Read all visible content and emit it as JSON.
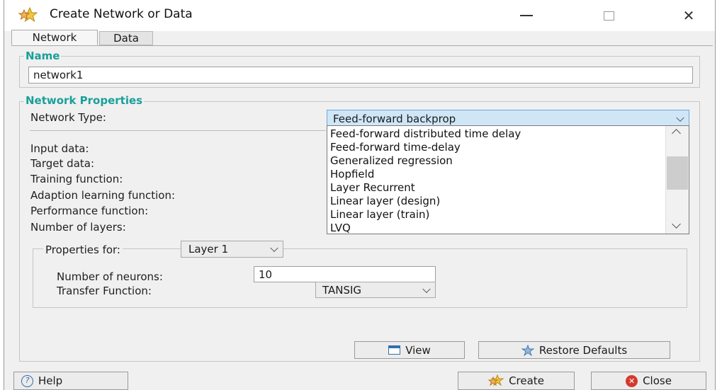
{
  "window": {
    "title": "Create Network or Data",
    "controls": {
      "minimize": "—",
      "maximize": "□",
      "close": "✕"
    }
  },
  "tabs": {
    "network": "Network",
    "data": "Data"
  },
  "name_group": {
    "legend": "Name",
    "value": "network1"
  },
  "properties": {
    "legend": "Network Properties",
    "network_type_label": "Network Type:",
    "network_type_value": "Feed-forward backprop",
    "labels": {
      "input": "Input data:",
      "target": "Target data:",
      "training": "Training function:",
      "adaption": "Adaption learning function:",
      "performance": "Performance function:",
      "layers": "Number of layers:"
    }
  },
  "network_type_options": [
    "Feed-forward distributed time delay",
    "Feed-forward time-delay",
    "Generalized regression",
    "Hopfield",
    "Layer Recurrent",
    "Linear layer (design)",
    "Linear layer (train)",
    "LVQ"
  ],
  "layer_props": {
    "legend": "Properties for:",
    "layer_value": "Layer 1",
    "neurons_label": "Number of neurons:",
    "neurons_value": "10",
    "transfer_label": "Transfer Function:",
    "transfer_value": "TANSIG"
  },
  "buttons": {
    "view": "View",
    "restore": "Restore Defaults",
    "help": "Help",
    "create": "Create",
    "close": "Close"
  },
  "colors": {
    "legend": "#1a9f9a",
    "window_bg": "#f0f0f0",
    "close_button_red": "#d33a2c"
  },
  "icons": {
    "app": "star-stack-icon",
    "view": "window-icon",
    "restore": "star-icon",
    "help": "help-circle-icon",
    "create": "star-stack-icon",
    "close": "close-circle-icon"
  }
}
